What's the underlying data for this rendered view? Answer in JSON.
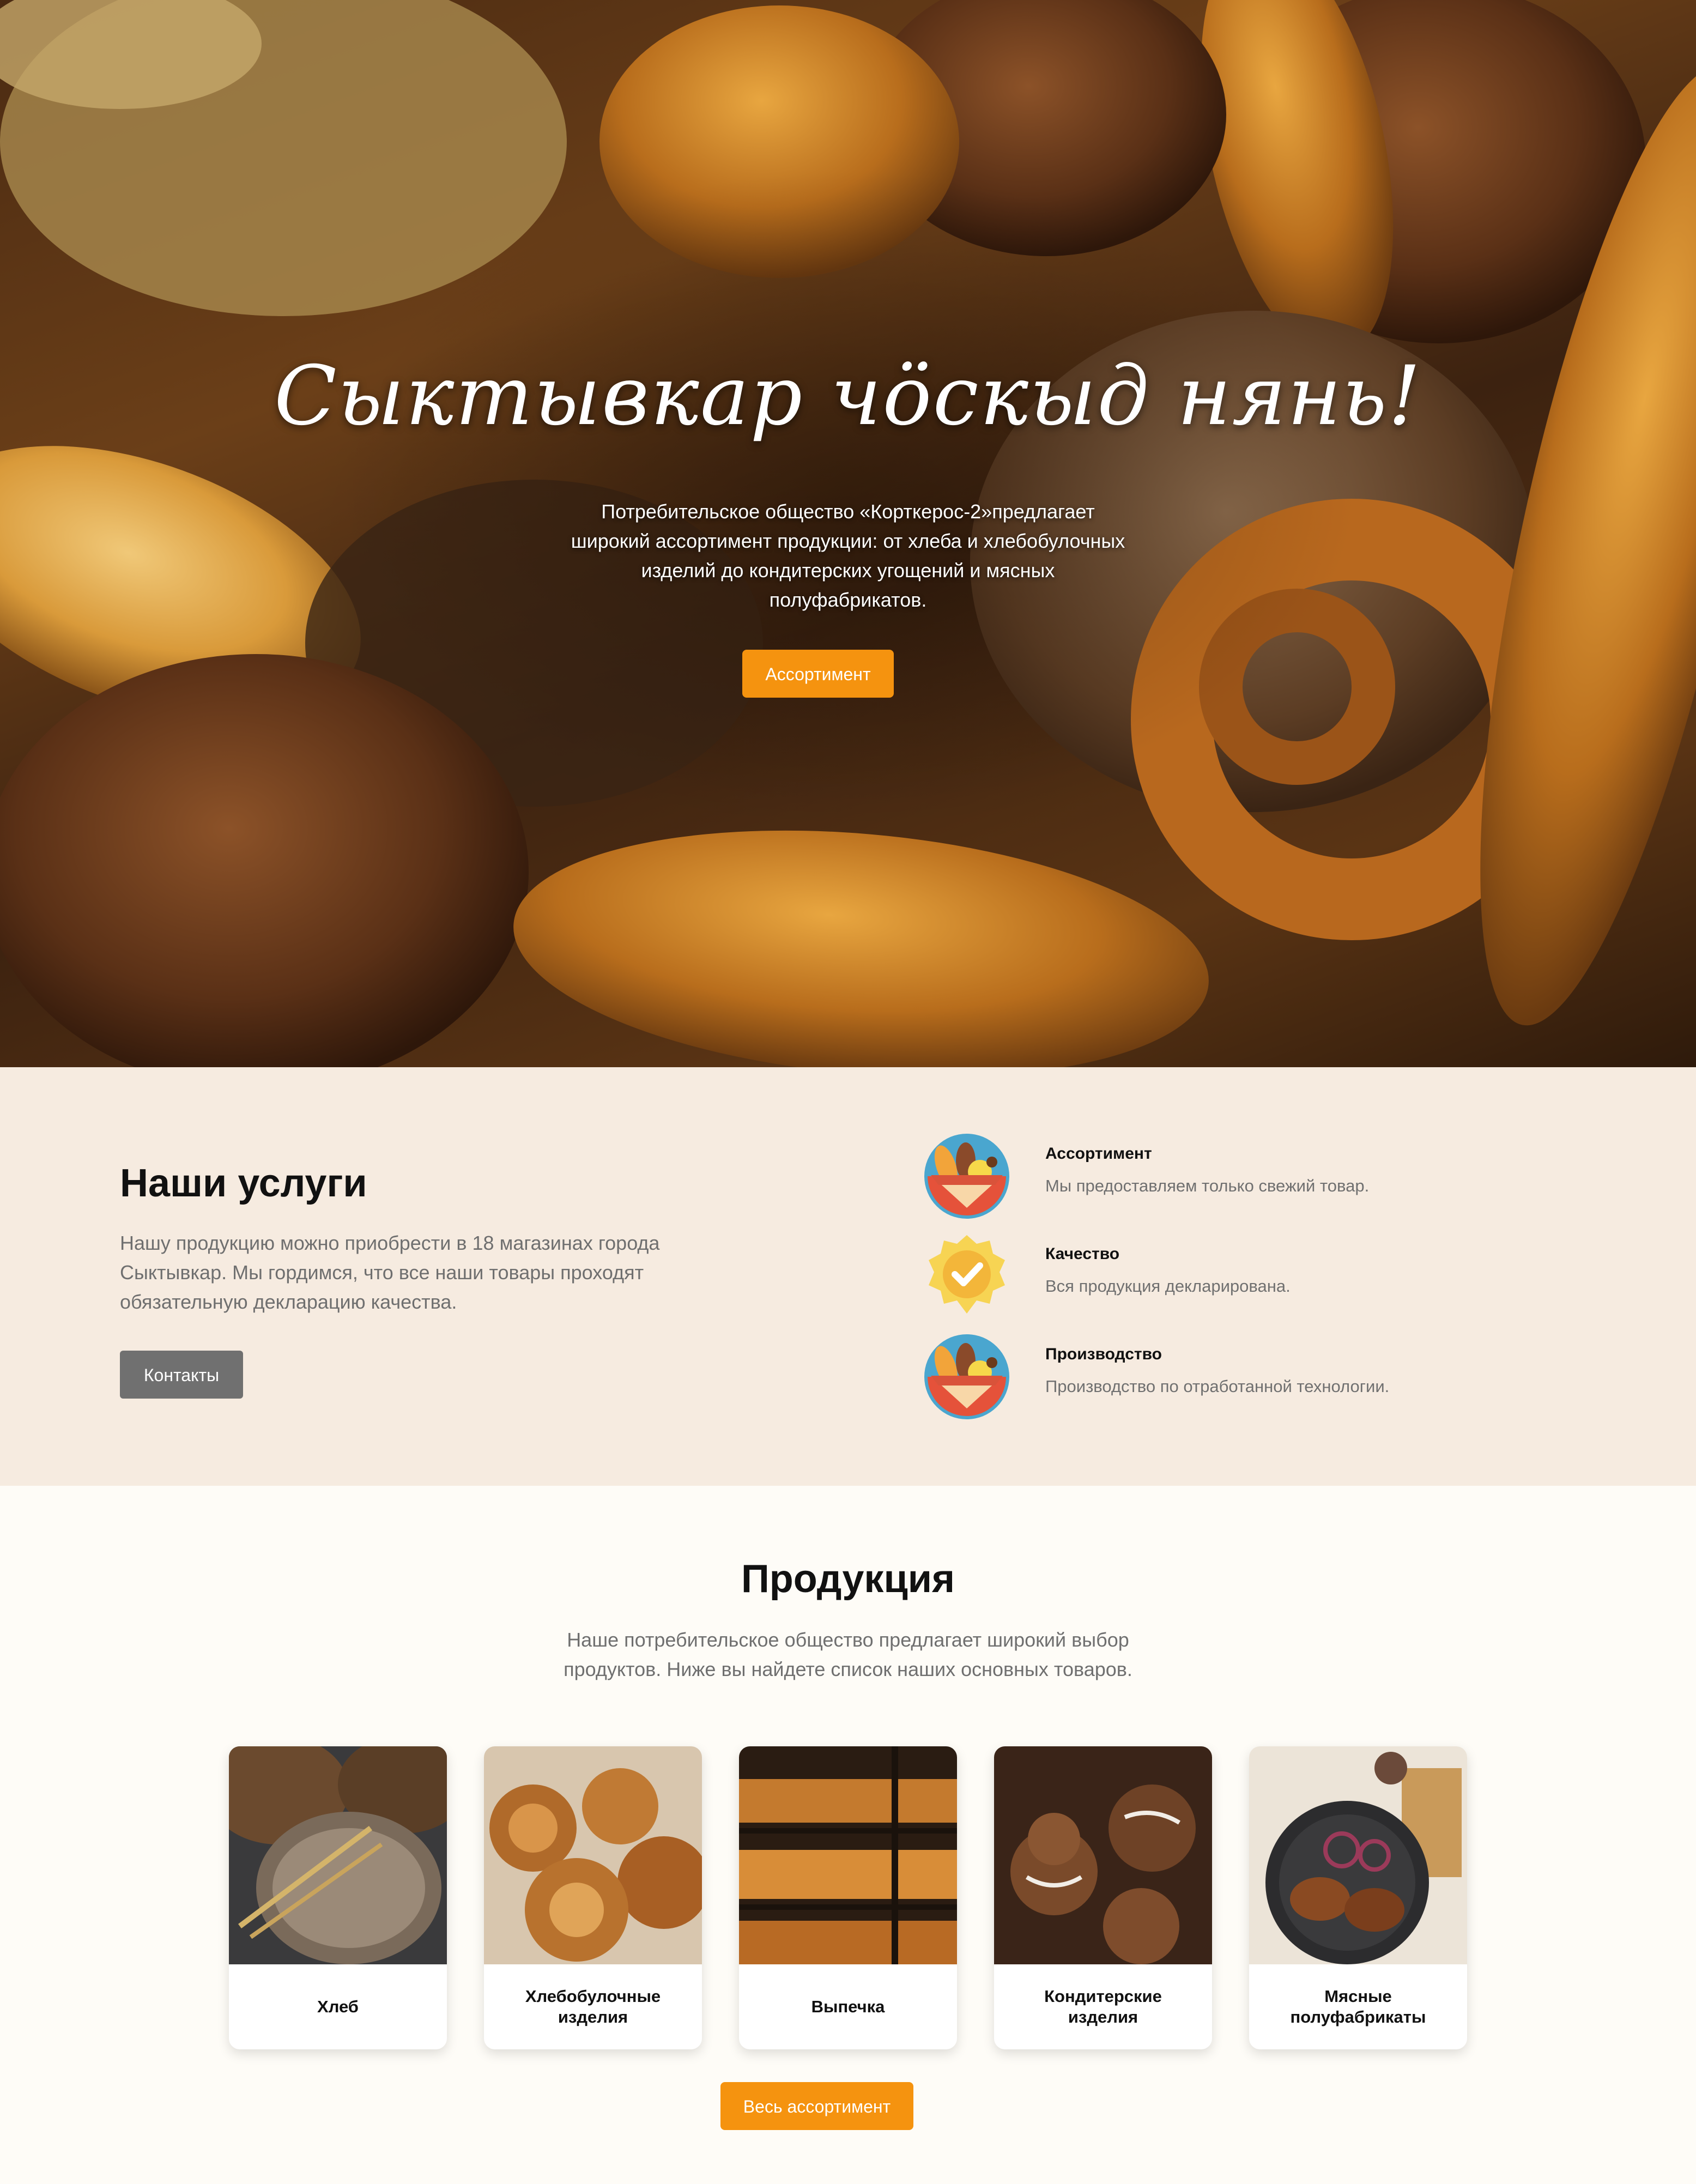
{
  "hero": {
    "title": "Сыктывкар чӧскыд нянь!",
    "description": "Потребительское общество «Корткерос-2»предлагает широкий ассортимент продукции: от хлеба и хлебобулочных изделий до кондитерских угощений и мясных полуфабрикатов.",
    "button_label": "Ассортимент"
  },
  "services": {
    "title": "Наши услуги",
    "description": "Нашу продукцию можно приобрести в 18 магазинах города Сыктывкар. Мы гордимся, что все наши товары проходят обязательную декларацию качества.",
    "button_label": "Контакты",
    "features": [
      {
        "title": "Ассортимент",
        "text": "Мы предоставляем только свежий товар.",
        "icon": "bread-basket-icon"
      },
      {
        "title": "Качество",
        "text": "Вся продукция декларирована.",
        "icon": "quality-badge-icon"
      },
      {
        "title": "Производство",
        "text": "Производство по отработанной технологии.",
        "icon": "bread-basket-icon"
      }
    ]
  },
  "products": {
    "title": "Продукция",
    "description": "Наше потребительское общество предлагает широкий выбор продуктов. Ниже вы найдете список наших основных товаров.",
    "items": [
      {
        "label": "Хлеб"
      },
      {
        "label": "Хлебобулочные изделия"
      },
      {
        "label": "Выпечка"
      },
      {
        "label": "Кондитерские изделия"
      },
      {
        "label": "Мясные полуфабрикаты"
      }
    ],
    "button_label": "Весь ассортимент"
  },
  "colors": {
    "accent": "#f5930f",
    "services_bg": "#f6ebe0",
    "products_bg": "#fefcf7",
    "secondary_button": "#707070"
  }
}
